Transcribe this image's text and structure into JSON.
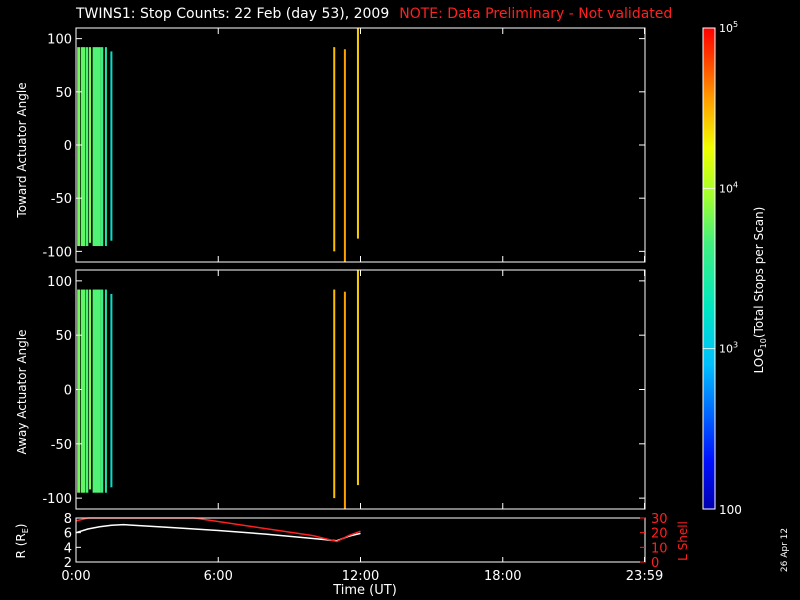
{
  "title": {
    "main": "TWINS1: Stop Counts: 22 Feb (day  53), 2009",
    "note": "NOTE: Data Preliminary - Not validated",
    "note_color": "#ff2020"
  },
  "x_axis": {
    "label": "Time (UT)",
    "ticks": [
      {
        "value": 0,
        "label": "0:00"
      },
      {
        "value": 6,
        "label": "6:00"
      },
      {
        "value": 12,
        "label": "12:00"
      },
      {
        "value": 18,
        "label": "18:00"
      },
      {
        "value": 23.98,
        "label": "23:59"
      }
    ],
    "range_hours": [
      0,
      24
    ]
  },
  "colorbar": {
    "label": "LOG10(Total Stops per Scan)",
    "label_parts": {
      "pre": "LOG",
      "sub": "10",
      "post": "(Total Stops per Scan)"
    },
    "ticks": [
      {
        "value": 2,
        "label": "100"
      },
      {
        "value": 3,
        "label": "10^3",
        "base": "10",
        "exp": "3"
      },
      {
        "value": 4,
        "label": "10^4",
        "base": "10",
        "exp": "4"
      },
      {
        "value": 5,
        "label": "10^5",
        "base": "10",
        "exp": "5"
      }
    ],
    "range_log10": [
      2,
      5
    ],
    "scale": "log"
  },
  "footer_date": "26 Apr 12",
  "chart_data": [
    {
      "type": "heatmap",
      "name": "toward",
      "ylabel": "Toward Actuator Angle",
      "ylim": [
        -110,
        110
      ],
      "y_ticks": [
        100,
        50,
        0,
        -50,
        -100
      ],
      "y_range_data": [
        -95,
        95
      ],
      "columns": [
        {
          "t": 0.05,
          "dt": 0.12,
          "log_counts": 3.8,
          "y": [
            -95,
            92
          ]
        },
        {
          "t": 0.2,
          "dt": 0.18,
          "log_counts": 3.75,
          "y": [
            -95,
            92
          ]
        },
        {
          "t": 0.4,
          "dt": 0.12,
          "log_counts": 3.7,
          "y": [
            -95,
            92
          ]
        },
        {
          "t": 0.55,
          "dt": 0.08,
          "log_counts": 3.85,
          "y": [
            -92,
            92
          ]
        },
        {
          "t": 0.7,
          "dt": 0.35,
          "log_counts": 3.7,
          "y": [
            -95,
            92
          ]
        },
        {
          "t": 1.05,
          "dt": 0.1,
          "log_counts": 3.6,
          "y": [
            -95,
            92
          ]
        },
        {
          "t": 1.22,
          "dt": 0.05,
          "log_counts": 3.4,
          "y": [
            -95,
            92
          ]
        },
        {
          "t": 1.45,
          "dt": 0.05,
          "log_counts": 3.2,
          "y": [
            -90,
            88
          ]
        },
        {
          "t": 10.85,
          "dt": 0.08,
          "log_counts": 4.45,
          "y": [
            -100,
            92
          ]
        },
        {
          "t": 11.3,
          "dt": 0.06,
          "log_counts": 4.55,
          "y": [
            -110,
            90
          ]
        },
        {
          "t": 11.85,
          "dt": 0.08,
          "log_counts": 4.4,
          "y": [
            -88,
            110
          ]
        }
      ]
    },
    {
      "type": "heatmap",
      "name": "away",
      "ylabel": "Away Actuator Angle",
      "ylim": [
        -110,
        110
      ],
      "y_ticks": [
        100,
        50,
        0,
        -50,
        -100
      ],
      "columns": [
        {
          "t": 0.05,
          "dt": 0.12,
          "log_counts": 3.8,
          "y": [
            -95,
            92
          ]
        },
        {
          "t": 0.2,
          "dt": 0.18,
          "log_counts": 3.75,
          "y": [
            -95,
            92
          ]
        },
        {
          "t": 0.4,
          "dt": 0.12,
          "log_counts": 3.7,
          "y": [
            -95,
            92
          ]
        },
        {
          "t": 0.55,
          "dt": 0.08,
          "log_counts": 3.85,
          "y": [
            -92,
            92
          ]
        },
        {
          "t": 0.7,
          "dt": 0.35,
          "log_counts": 3.7,
          "y": [
            -95,
            92
          ]
        },
        {
          "t": 1.05,
          "dt": 0.1,
          "log_counts": 3.6,
          "y": [
            -95,
            92
          ]
        },
        {
          "t": 1.22,
          "dt": 0.05,
          "log_counts": 3.4,
          "y": [
            -95,
            92
          ]
        },
        {
          "t": 1.45,
          "dt": 0.05,
          "log_counts": 3.2,
          "y": [
            -90,
            88
          ]
        },
        {
          "t": 10.85,
          "dt": 0.08,
          "log_counts": 4.45,
          "y": [
            -100,
            92
          ]
        },
        {
          "t": 11.3,
          "dt": 0.06,
          "log_counts": 4.55,
          "y": [
            -110,
            90
          ]
        },
        {
          "t": 11.85,
          "dt": 0.08,
          "log_counts": 4.4,
          "y": [
            -88,
            110
          ]
        }
      ]
    },
    {
      "type": "line",
      "name": "orbit",
      "ylabel_left": "R (RE)",
      "ylabel_left_parts": {
        "pre": "R (R",
        "sub": "E",
        "post": ")"
      },
      "ylabel_right": "L Shell",
      "ylim_left": [
        2,
        8
      ],
      "yticks_left": [
        8,
        6,
        4,
        2
      ],
      "ylim_right": [
        0,
        30
      ],
      "yticks_right": [
        30,
        20,
        10,
        0
      ],
      "right_color": "#ff2020",
      "series": [
        {
          "axis": "left",
          "color": "#ffffff",
          "x": [
            0,
            0.5,
            1.0,
            1.5,
            2.0,
            4.0,
            6.0,
            8.0,
            10.0,
            11.0,
            11.5,
            12.0
          ],
          "y": [
            6.0,
            6.5,
            6.8,
            7.0,
            7.1,
            6.7,
            6.3,
            5.8,
            5.2,
            4.9,
            5.5,
            5.9
          ]
        },
        {
          "axis": "right",
          "color": "#ff2020",
          "x": [
            0,
            0.5,
            0.8,
            5.0,
            10.0,
            11.0,
            11.5,
            12.0
          ],
          "y": [
            28,
            30,
            31,
            30,
            18,
            14,
            18,
            21
          ]
        }
      ]
    }
  ]
}
